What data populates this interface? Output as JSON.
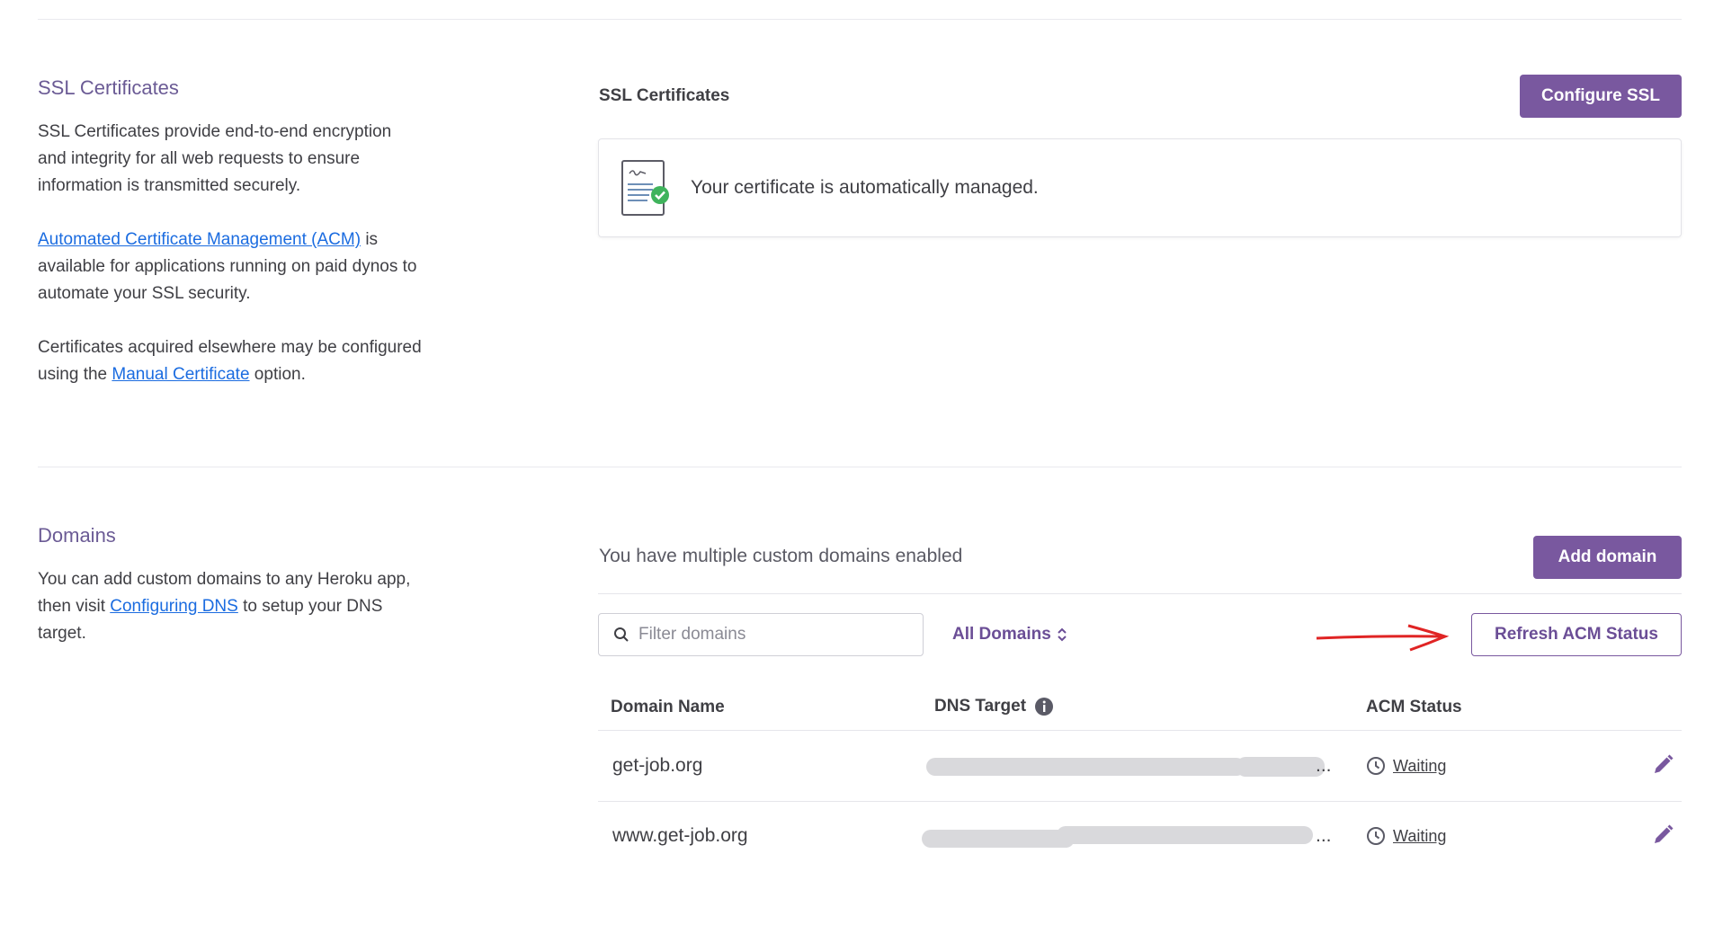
{
  "ssl": {
    "title": "SSL Certificates",
    "desc1": "SSL Certificates provide end-to-end encryption and integrity for all web requests to ensure information is transmitted securely.",
    "acm_link": "Automated Certificate Management (ACM)",
    "desc2_tail": " is available for applications running on paid dynos to automate your SSL security.",
    "desc3_head": "Certificates acquired elsewhere may be configured using the ",
    "manual_link": "Manual Certificate",
    "desc3_tail": " option.",
    "panel_title": "SSL Certificates",
    "configure_button": "Configure SSL",
    "card_text": "Your certificate is automatically managed."
  },
  "domains": {
    "title": "Domains",
    "desc_head": "You can add custom domains to any Heroku app, then visit ",
    "dns_link": "Configuring DNS",
    "desc_tail": " to setup your DNS target.",
    "summary": "You have multiple custom domains enabled",
    "add_button": "Add domain",
    "filter_placeholder": "Filter domains",
    "filter_dropdown": "All Domains",
    "refresh_button": "Refresh ACM Status",
    "columns": [
      "Domain Name",
      "DNS Target",
      "ACM Status"
    ],
    "rows": [
      {
        "domain": "get-job.org",
        "dns_tail": "...",
        "status": "Waiting"
      },
      {
        "domain": "www.get-job.org",
        "dns_tail": "...",
        "status": "Waiting"
      }
    ]
  },
  "colors": {
    "accent": "#79589f",
    "link": "#1b6ce0",
    "annotation_arrow": "#e02424"
  }
}
